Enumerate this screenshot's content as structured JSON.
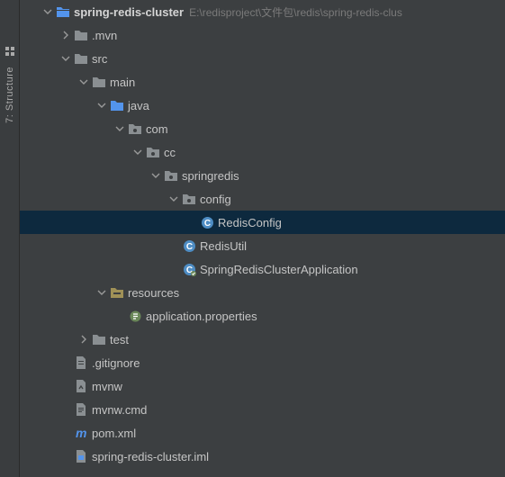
{
  "sidebar": {
    "structure_label": "7: Structure"
  },
  "tree": {
    "root": {
      "name": "spring-redis-cluster",
      "path_hint": "E:\\redisproject\\文件包\\redis\\spring-redis-clus"
    },
    "mvn": ".mvn",
    "src": "src",
    "main": "main",
    "java": "java",
    "com": "com",
    "cc": "cc",
    "springredis": "springredis",
    "config": "config",
    "redis_config": "RedisConfig",
    "redis_util": "RedisUtil",
    "spring_app": "SpringRedisClusterApplication",
    "resources": "resources",
    "app_props": "application.properties",
    "test": "test",
    "gitignore": ".gitignore",
    "mvnw": "mvnw",
    "mvnw_cmd": "mvnw.cmd",
    "pom": "pom.xml",
    "iml": "spring-redis-cluster.iml"
  }
}
